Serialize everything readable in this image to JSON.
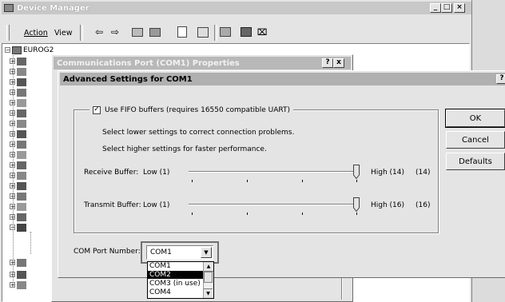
{
  "device_manager": {
    "title": "Device Manager",
    "menu": {
      "action": "Action",
      "view": "View"
    },
    "tree_root": "EUROG2"
  },
  "comm_props": {
    "title": "Communications Port (COM1) Properties",
    "help": "?",
    "close": "x"
  },
  "advanced": {
    "title": "Advanced Settings for COM1",
    "help": "?",
    "fifo": {
      "label": "Use FIFO buffers (requires 16550 compatible UART)",
      "checked": true
    },
    "hint_lower": "Select lower settings to correct connection problems.",
    "hint_higher": "Select higher settings for faster performance.",
    "receive": {
      "label": "Receive Buffer:",
      "low": "Low (1)",
      "high": "High (14)",
      "value_text": "(14)",
      "value": 14,
      "max": 14
    },
    "transmit": {
      "label": "Transmit Buffer:",
      "low": "Low (1)",
      "high": "High (16)",
      "value_text": "(16)",
      "value": 16,
      "max": 16
    },
    "com_port": {
      "label": "COM Port Number:",
      "selected": "COM1",
      "options": [
        "COM1",
        "COM2",
        "COM3 (in use)",
        "COM4"
      ],
      "highlighted": "COM2"
    },
    "buttons": {
      "ok": "OK",
      "cancel": "Cancel",
      "defaults": "Defaults"
    }
  },
  "colors": {
    "selection": "#000000",
    "dialog_bg": "#e4e4e4",
    "titlebar": "#b8b8b8"
  }
}
